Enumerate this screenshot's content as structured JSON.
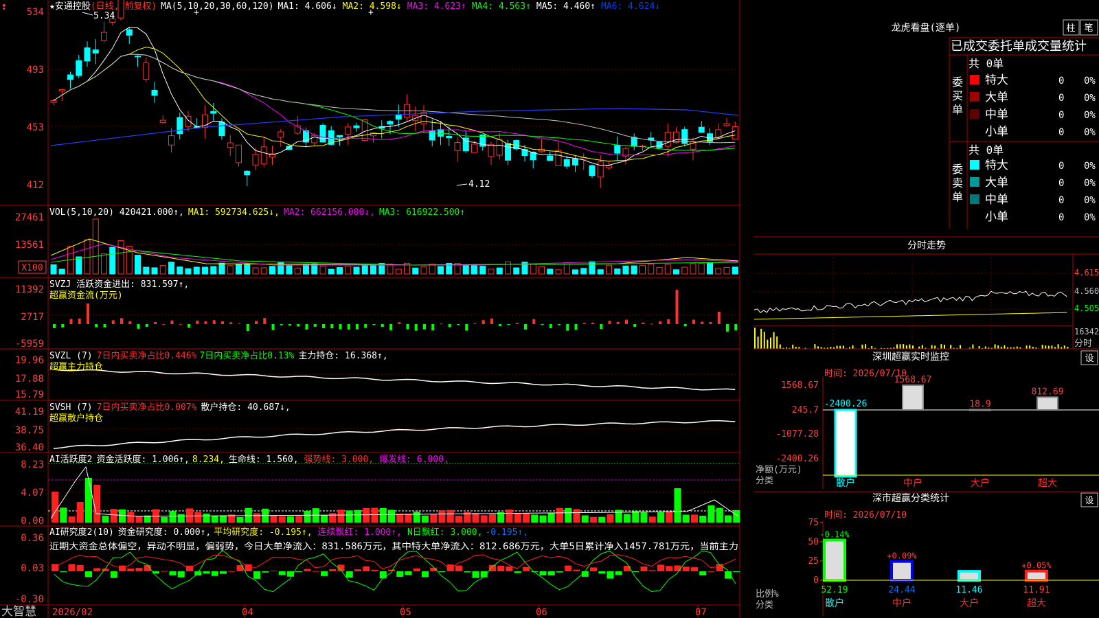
{
  "stock": {
    "star": "★",
    "name": "安通控股",
    "period": "(日线, 前复权)",
    "ma_params": "MA(5,10,20,30,60,120)",
    "ma1": "MA1: 4.606↓",
    "ma2": "MA2: 4.598↓",
    "ma3": "MA3: 4.623↑",
    "ma4": "MA4: 4.563↑",
    "ma5": "MA5: 4.460↑",
    "ma6": "MA6: 4.624↓",
    "high_mark": "5.34",
    "low_mark": "4.12"
  },
  "axes": {
    "price": [
      "534",
      "493",
      "453",
      "412"
    ],
    "vol": [
      "27461",
      "13561"
    ],
    "vol_unit": "X100",
    "svzj": [
      "11392",
      "2717",
      "-5959"
    ],
    "svzl": [
      "19.96",
      "17.88",
      "15.79"
    ],
    "svsh": [
      "41.19",
      "38.75",
      "36.40"
    ],
    "ai1": [
      "8.23",
      "4.07",
      "0.00"
    ],
    "ai2": [
      "0.36",
      "0.03",
      "-0.30"
    ],
    "dates": [
      "2026/02",
      "04",
      "05",
      "06",
      "07"
    ]
  },
  "vol_panel": {
    "name": "VOL(5,10,20)",
    "val": "420421.000↑,",
    "ma1": "MA1: 592734.625↓,",
    "ma2": "MA2: 662156.000↓,",
    "ma3": "MA3: 616922.500↑"
  },
  "svzj_panel": {
    "title": "SVZJ  活跃资金进出: 831.597↑,",
    "sub": "超赢资金流(万元)"
  },
  "svzl_panel": {
    "name": "SVZL (7)",
    "red": "7日内买卖净占比0.446%",
    "green": "7日内买卖净占比0.13%",
    "white": "主力持仓: 16.368↑,",
    "sub": "超赢主力持仓"
  },
  "svsh_panel": {
    "name": "SVSH (7)",
    "red": "7日内买卖净占比0.007%",
    "white": "散户持仓: 40.687↓,",
    "sub": "超赢散户持仓"
  },
  "ai1_panel": {
    "name": "AI活跃度2",
    "a": "资金活跃度: 1.006↑,",
    "b": "8.234,",
    "c": "生命线: 1.560,",
    "d": "强势线: 3.000,",
    "e": "爆发线: 6.000,"
  },
  "ai2_panel": {
    "name": "AI研究度2(10)",
    "a": "资金研究度: 0.000↑,",
    "b": "平均研究度: -0.195↑,",
    "c": "连续飘红: 1.000↑,",
    "d": "N日飘红: 3.000,",
    "e": "-0.195↑,",
    "text": "近期大资金总体偏空，异动不明显，偏弱势，今日大单净流入：831.586万元，其中特大单净流入：812.686万元，大单5日累计净入1457.781万元，当前主力"
  },
  "footer": {
    "brand": "大智慧"
  },
  "longhu": {
    "title": "龙虎看盘(逐单)",
    "btn_zhu": "柱",
    "btn_bi": "笔",
    "stats_title": "已成交委托单成交量统计",
    "buy_label": "委买单",
    "sell_label": "委卖单",
    "buy_total": "共 0单",
    "sell_total": "共 0单",
    "buy_rows": [
      {
        "label": "特大",
        "count": "0",
        "pct": "0%",
        "color": "#ff0000"
      },
      {
        "label": "大单",
        "count": "0",
        "pct": "0%",
        "color": "#a00000"
      },
      {
        "label": "中单",
        "count": "0",
        "pct": "0%",
        "color": "#600000"
      },
      {
        "label": "小单",
        "count": "0",
        "pct": "0%",
        "color": "#000000"
      }
    ],
    "sell_rows": [
      {
        "label": "特大",
        "count": "0",
        "pct": "0%",
        "color": "#00ffff"
      },
      {
        "label": "大单",
        "count": "0",
        "pct": "0%",
        "color": "#009a9a"
      },
      {
        "label": "中单",
        "count": "0",
        "pct": "0%",
        "color": "#007878"
      },
      {
        "label": "小单",
        "count": "0",
        "pct": "0%",
        "color": "#000000"
      }
    ]
  },
  "intraday": {
    "title": "分时走势",
    "prices": [
      "4.615",
      "4.560",
      "4.505"
    ],
    "vol": "16342",
    "vol_label": "分时"
  },
  "monitor": {
    "title": "深圳超赢实时监控",
    "btn": "设",
    "time": "时间: 2026/07/10",
    "ylabels": [
      "1568.67",
      "245.7",
      "-1077.28",
      "-2400.26"
    ],
    "unit1": "净额(万元)",
    "unit2": "分类",
    "bars": [
      {
        "cat": "散户",
        "label": "-2400.26",
        "value": -2400.26
      },
      {
        "cat": "中户",
        "label": "1568.67",
        "value": 1568.67
      },
      {
        "cat": "大户",
        "label": "18.9",
        "value": 18.9
      },
      {
        "cat": "超大",
        "label": "812.69",
        "value": 812.69
      }
    ]
  },
  "stats": {
    "title": "深市超赢分类统计",
    "btn": "设",
    "time": "时间: 2026/07/10",
    "ylabels": [
      "75",
      "50",
      "25",
      "0"
    ],
    "unit1": "比例%",
    "unit2": "分类",
    "bars": [
      {
        "cat": "散户",
        "value": 52.19,
        "vlabel": "52.19",
        "top": "-0.14%"
      },
      {
        "cat": "中户",
        "value": 24.44,
        "vlabel": "24.44",
        "top": "+0.09%"
      },
      {
        "cat": "大户",
        "value": 11.46,
        "vlabel": "11.46",
        "top": ""
      },
      {
        "cat": "超大",
        "value": 11.91,
        "vlabel": "11.91",
        "top": "+0.05%"
      }
    ]
  }
}
